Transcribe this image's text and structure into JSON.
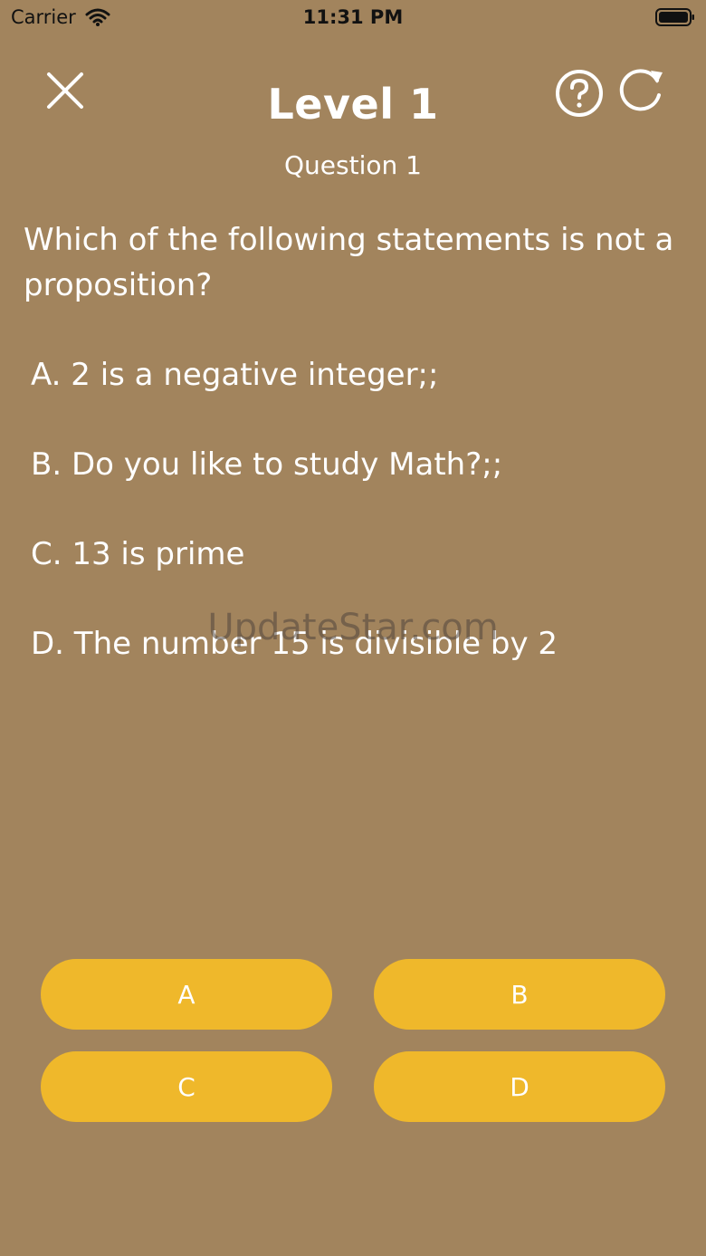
{
  "status_bar": {
    "carrier": "Carrier",
    "time": "11:31 PM"
  },
  "header": {
    "level_title": "Level 1",
    "question_number": "Question 1",
    "close_icon": "close-icon",
    "help_icon": "help-icon",
    "reload_icon": "reload-icon"
  },
  "question": {
    "text": "Which of the following statements is not a proposition?",
    "options": [
      "A. 2 is a negative integer;;",
      "B. Do you like to study Math?;;",
      "C. 13 is prime",
      "D. The number 15 is divisible by 2"
    ]
  },
  "answers": {
    "a": "A",
    "b": "B",
    "c": "C",
    "d": "D"
  },
  "watermark": "UpdateStar.com",
  "colors": {
    "background": "#a2845d",
    "button": "#efb82b",
    "text": "#ffffff"
  }
}
